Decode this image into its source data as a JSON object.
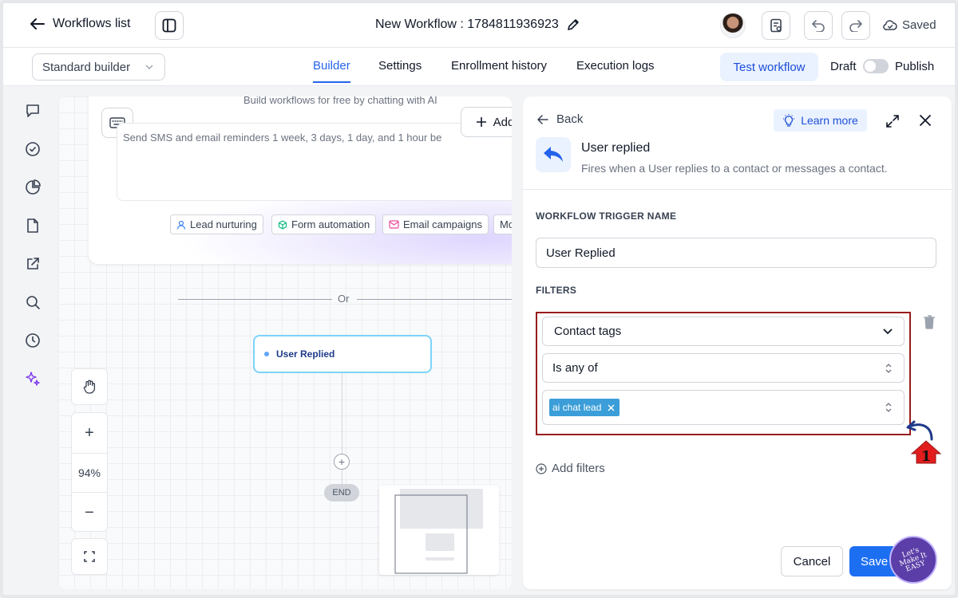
{
  "topbar": {
    "back_label": "Workflows list",
    "workflow_title": "New Workflow : 1784811936923",
    "saved_label": "Saved"
  },
  "navbar": {
    "builder_select": "Standard builder",
    "tabs": [
      {
        "label": "Builder",
        "active": true
      },
      {
        "label": "Settings",
        "active": false
      },
      {
        "label": "Enrollment history",
        "active": false
      },
      {
        "label": "Execution logs",
        "active": false
      }
    ],
    "test_workflow": "Test workflow",
    "draft_label": "Draft",
    "publish_label": "Publish"
  },
  "rail": {
    "icons": [
      "chat-icon",
      "check-circle-icon",
      "pie-chart-icon",
      "document-icon",
      "external-link-icon",
      "search-icon",
      "history-icon",
      "sparkle-icon"
    ]
  },
  "canvas": {
    "ai_header": "Build workflows for free by chatting with AI",
    "ai_placeholder": "Send SMS and email reminders 1 week, 3 days, 1 day, and 1 hour be",
    "add_label": "Add",
    "chips": [
      {
        "label": "Lead nurturing",
        "icon": "user-icon",
        "color": "#3b82f6"
      },
      {
        "label": "Form automation",
        "icon": "cube-icon",
        "color": "#10b981"
      },
      {
        "label": "Email campaigns",
        "icon": "mail-icon",
        "color": "#ec4899"
      },
      {
        "label": "Mo",
        "icon": "",
        "color": "#374151"
      }
    ],
    "or_label": "Or",
    "trigger_node": "User Replied",
    "end_label": "END",
    "zoom_percent": "94%"
  },
  "panel": {
    "back_label": "Back",
    "learn_more": "Learn more",
    "trigger_title": "User replied",
    "trigger_desc": "Fires when a User replies to a contact or messages a contact.",
    "name_section": "WORKFLOW TRIGGER NAME",
    "name_value": "User Replied",
    "filters_section": "FILTERS",
    "filter_field": "Contact tags",
    "filter_operator": "Is any of",
    "filter_tag": "ai chat lead",
    "add_filters": "Add filters",
    "cancel_label": "Cancel",
    "save_label": "Save"
  },
  "annotation": {
    "number": "1",
    "badge_text": "Let's Make It EASY"
  },
  "colors": {
    "accent": "#2563eb",
    "highlight_border": "#991b1b",
    "tag_bg": "#3b9ed8",
    "annotation_red": "#e11d1d"
  }
}
